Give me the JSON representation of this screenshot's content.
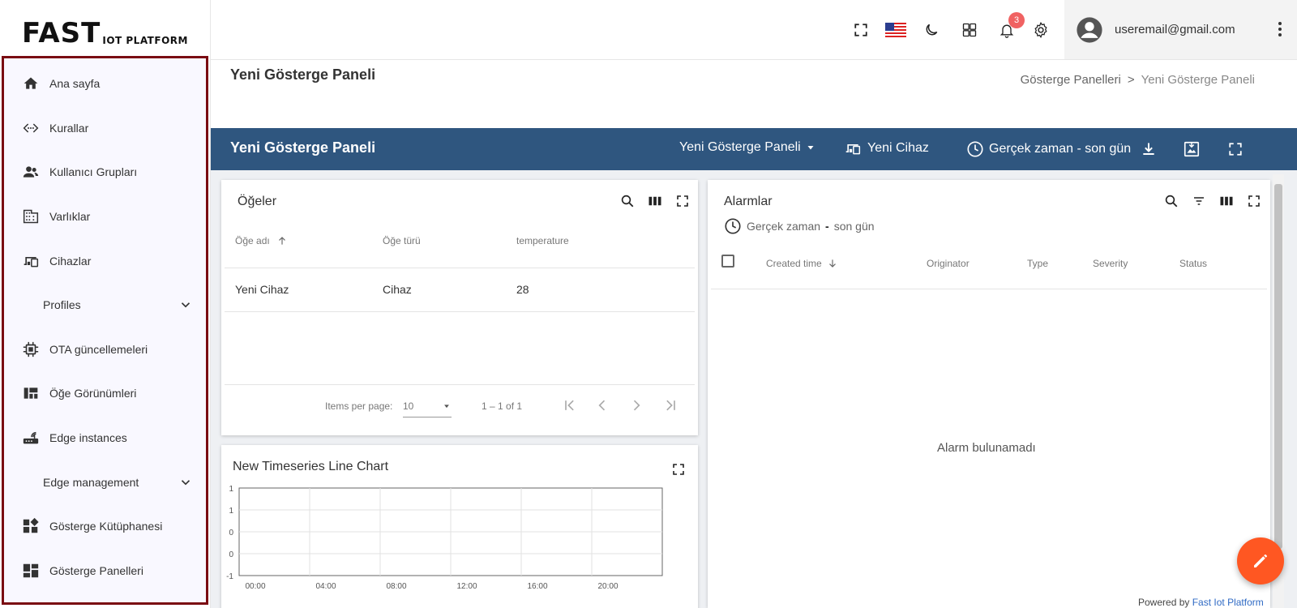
{
  "brand": {
    "logo_big": "FAST",
    "logo_small": "IOT PLATFORM"
  },
  "sidebar": {
    "items": [
      {
        "label": "Ana sayfa",
        "icon": "home-icon"
      },
      {
        "label": "Kurallar",
        "icon": "code-icon"
      },
      {
        "label": "Kullanıcı Grupları",
        "icon": "users-icon"
      },
      {
        "label": "Varlıklar",
        "icon": "building-icon"
      },
      {
        "label": "Cihazlar",
        "icon": "devices-icon"
      },
      {
        "label": "Profiles",
        "icon": "chevron-down-icon"
      },
      {
        "label": "OTA güncellemeleri",
        "icon": "chip-icon"
      },
      {
        "label": "Öğe Görünümleri",
        "icon": "view-quilt-icon"
      },
      {
        "label": "Edge instances",
        "icon": "router-icon"
      },
      {
        "label": "Edge management",
        "icon": "chevron-down-icon"
      },
      {
        "label": "Gösterge Kütüphanesi",
        "icon": "widgets-icon"
      },
      {
        "label": "Gösterge Panelleri",
        "icon": "dashboard-icon"
      }
    ]
  },
  "topbar": {
    "notification_count": "3",
    "user_email": "useremail@gmail.com"
  },
  "page": {
    "title": "Yeni Gösterge Paneli",
    "breadcrumb": {
      "parent": "Gösterge Panelleri",
      "separator": ">",
      "current": "Yeni Gösterge Paneli"
    }
  },
  "dashbar": {
    "title": "Yeni Gösterge Paneli",
    "state_select": "Yeni Gösterge Paneli",
    "entity": "Yeni Cihaz",
    "timewindow": "Gerçek zaman - son gün"
  },
  "entities_card": {
    "title": "Öğeler",
    "columns": [
      "Öğe adı",
      "Öğe türü",
      "temperature"
    ],
    "rows": [
      [
        "Yeni Cihaz",
        "Cihaz",
        "28"
      ]
    ],
    "items_per_page_label": "Items per page:",
    "items_per_page": "10",
    "range": "1 – 1 of 1"
  },
  "chart_card": {
    "title": "New Timeseries Line Chart"
  },
  "chart_data": {
    "type": "line",
    "title": "New Timeseries Line Chart",
    "x_ticks": [
      "00:00",
      "04:00",
      "08:00",
      "12:00",
      "16:00",
      "20:00"
    ],
    "y_ticks": [
      "1",
      "1",
      "0",
      "0",
      "-1"
    ],
    "series": [],
    "grid": true
  },
  "alarms_card": {
    "title": "Alarmlar",
    "timewindow_prefix": "Gerçek zaman",
    "timewindow_sep": "-",
    "timewindow_suffix": "son gün",
    "columns": [
      "Created time",
      "Originator",
      "Type",
      "Severity",
      "Status"
    ],
    "empty": "Alarm bulunamadı"
  },
  "footer": {
    "powered_by": "Powered by",
    "brand": "Fast Iot Platform"
  },
  "colors": {
    "dash_bar": "#2f567f",
    "accent": "#ff5722",
    "menu_border": "#7a0b12",
    "badge": "#f06262"
  }
}
